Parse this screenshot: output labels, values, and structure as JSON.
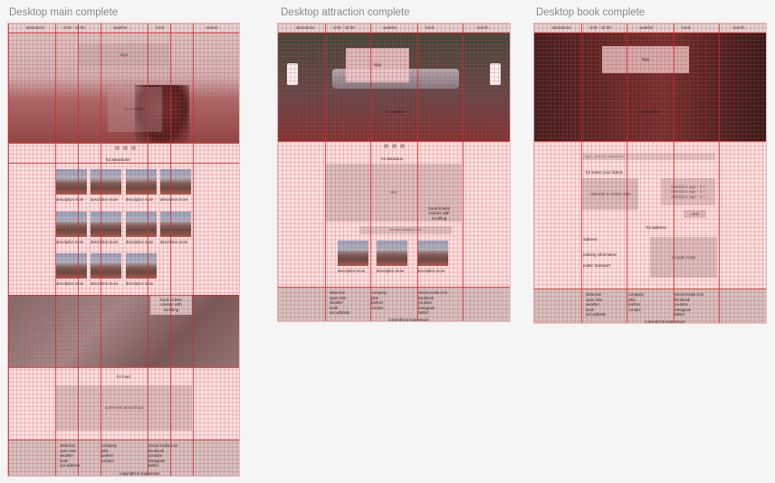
{
  "frames": {
    "main": {
      "title": "Desktop main complete"
    },
    "attraction": {
      "title": "Desktop attraction complete"
    },
    "book": {
      "title": "Desktop book complete"
    }
  },
  "nav": {
    "attractions": "attractions",
    "hours": "8:00 - 18:00",
    "weather": "weather",
    "book": "book",
    "search": "search"
  },
  "main": {
    "logo": "logo",
    "headline": "h1 headline",
    "h2_attractions": "h2 attractions",
    "thumb_label": "description more",
    "book_tickets": "book tickets\ncruises with\nscrolling",
    "h2_food": "h2 food",
    "food_text": "some text about food"
  },
  "attraction": {
    "logo": "logo",
    "headline": "h1 headline",
    "h2_attraction": "h2 attraction",
    "text": "text",
    "book_tickets": "book tickets\ncruises with\nscrolling",
    "more_label": "favorite attraction here",
    "thumb_label": "description more"
  },
  "book": {
    "logo": "logo",
    "headline": "h1 headline",
    "banner": "logo - welcome, attractions!",
    "h2_select": "h2 select your tickets",
    "calendar": "calendar to select date",
    "checkbox_1": "checkbox age - 1 +",
    "checkbox_2": "checkbox age - 1 +",
    "checkbox_3": "checkbox age - 1 +",
    "next": "next",
    "h2_address": "h2 address",
    "address": "address",
    "parking": "parking information",
    "transport": "public transport",
    "maps": "Google maps"
  },
  "footer": {
    "col1": "attraction\nopen time\nweather\nbook\nour address",
    "col2": "company\njobs\npartner\ncontact",
    "col3": "social media icon\nfacebook\nyoutube\ninstagram\ntwitter",
    "copyright": "copyright & impressum"
  },
  "colors": {
    "grid": "#dc3c3c",
    "frame_bg": "#fbe3e3",
    "nav_bg": "#ddd7d7"
  }
}
